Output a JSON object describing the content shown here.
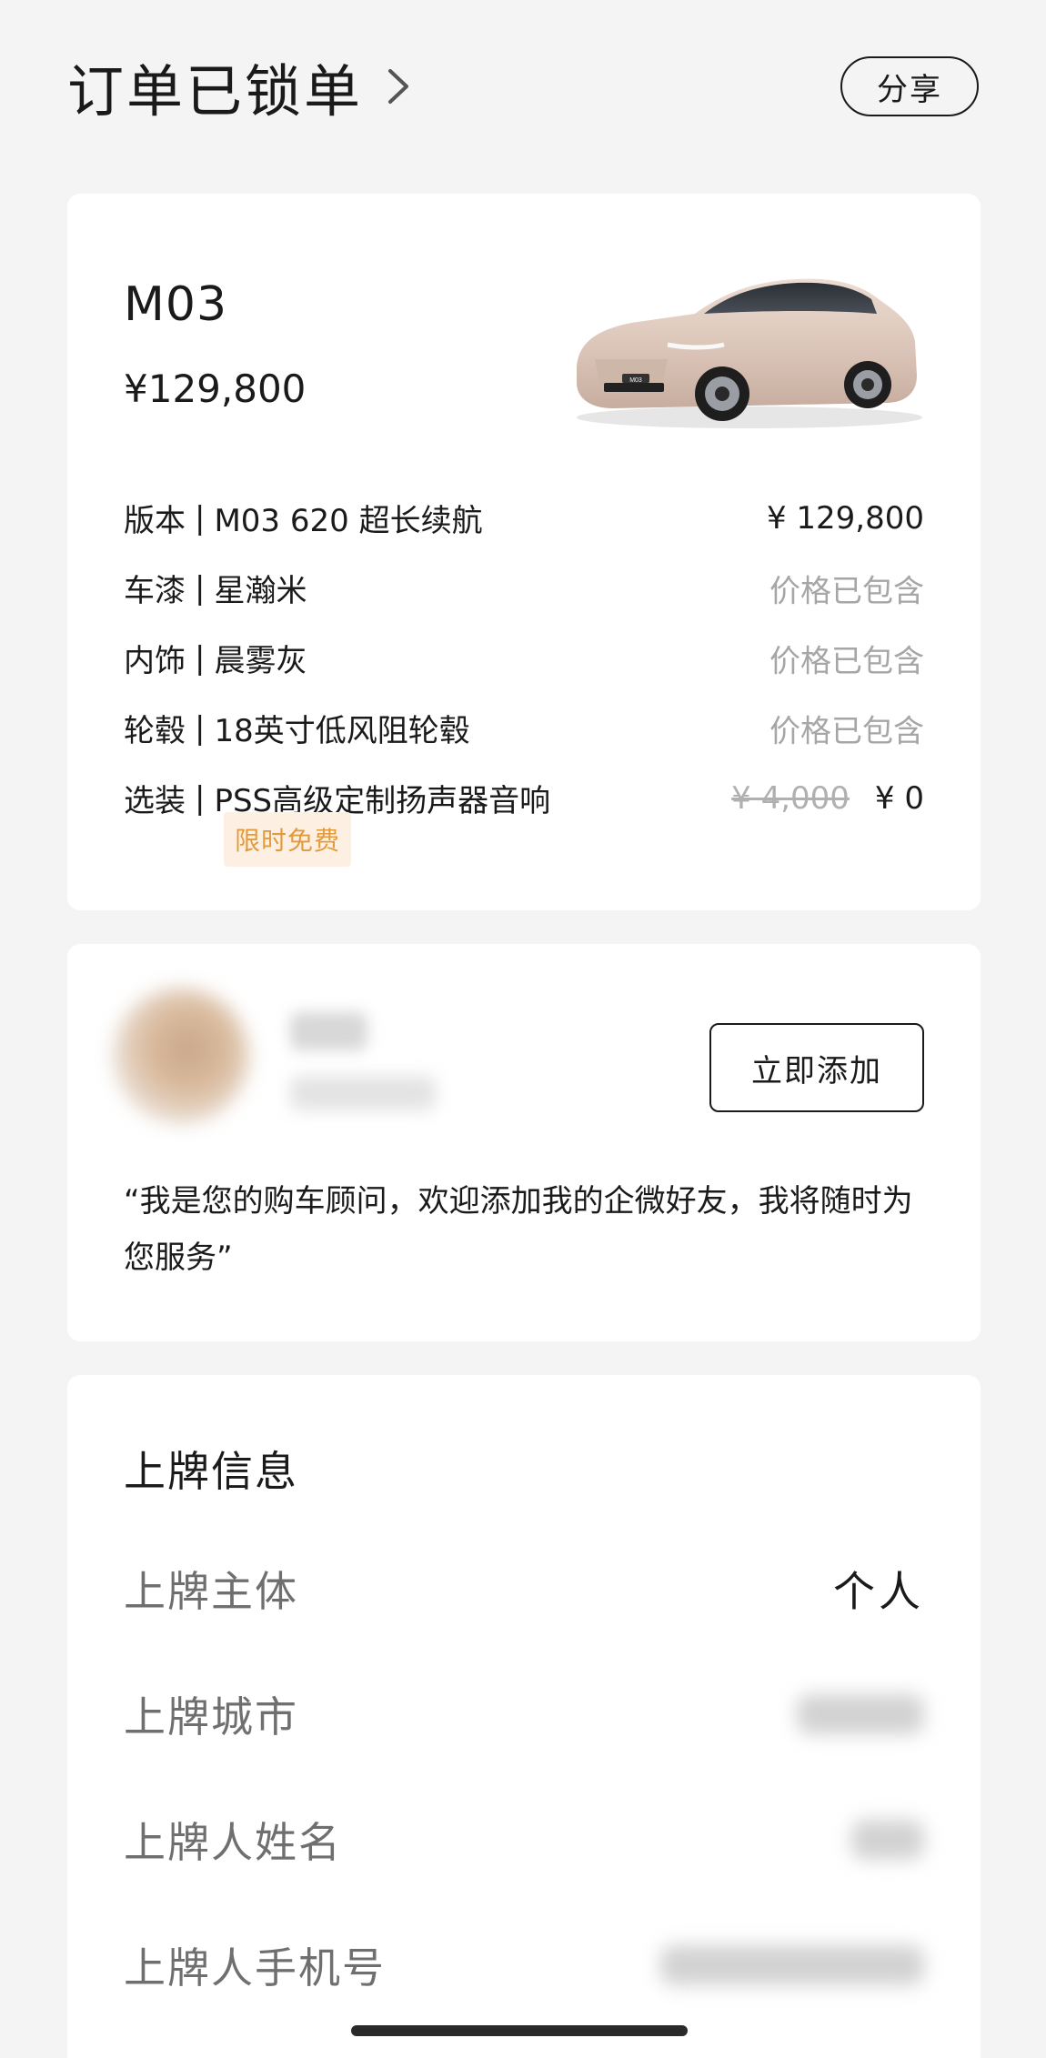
{
  "header": {
    "title": "订单已锁单",
    "share_label": "分享"
  },
  "car": {
    "model": "M03",
    "price": "¥129,800",
    "specs": [
      {
        "label": "版本",
        "sep": "|",
        "value": "M03 620 超长续航",
        "price": "¥ 129,800",
        "muted": false
      },
      {
        "label": "车漆",
        "sep": "|",
        "value": "星瀚米",
        "price": "价格已包含",
        "muted": true
      },
      {
        "label": "内饰",
        "sep": "|",
        "value": "晨雾灰",
        "price": "价格已包含",
        "muted": true
      },
      {
        "label": "轮毂",
        "sep": "|",
        "value": "18英寸低风阻轮毂",
        "price": "价格已包含",
        "muted": true
      },
      {
        "label": "选装",
        "sep": "|",
        "value": "PSS高级定制扬声器音响",
        "original_price": "¥ 4,000",
        "price": "¥ 0",
        "muted": false
      }
    ],
    "badge": "限时免费",
    "image_badge_text": "M03"
  },
  "advisor": {
    "add_label": "立即添加",
    "quote": "“我是您的购车顾问，欢迎添加我的企微好友，我将随时为您服务”"
  },
  "plate_info": {
    "title": "上牌信息",
    "rows": [
      {
        "label": "上牌主体",
        "value": "个人"
      },
      {
        "label": "上牌城市",
        "value": ""
      },
      {
        "label": "上牌人姓名",
        "value": ""
      },
      {
        "label": "上牌人手机号",
        "value": ""
      }
    ]
  },
  "colors": {
    "background": "#f4f4f4",
    "card": "#ffffff",
    "text": "#1a1a1a",
    "muted": "#a6a6a6",
    "badge_bg": "#fdf0e2",
    "badge_text": "#e39a3a"
  },
  "icons": {
    "title_chevron": "chevron-right-icon"
  }
}
